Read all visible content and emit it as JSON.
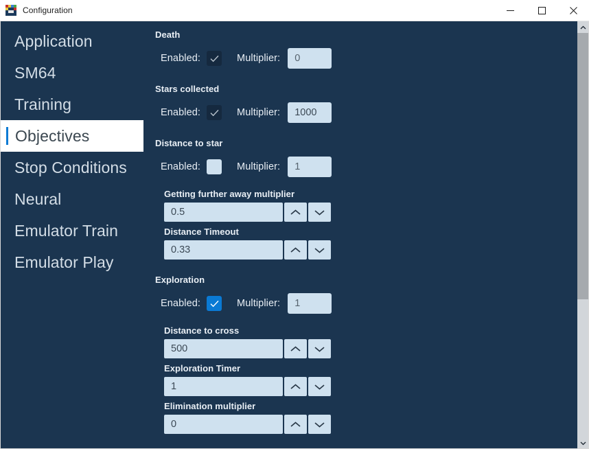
{
  "window": {
    "title": "Configuration",
    "icon": "app-icon",
    "controls": {
      "minimize": "minimize-icon",
      "maximize": "maximize-icon",
      "close": "close-icon"
    }
  },
  "sidebar": {
    "items": [
      {
        "label": "Application",
        "selected": false
      },
      {
        "label": "SM64",
        "selected": false
      },
      {
        "label": "Training",
        "selected": false
      },
      {
        "label": "Objectives",
        "selected": true
      },
      {
        "label": "Stop Conditions",
        "selected": false
      },
      {
        "label": "Neural",
        "selected": false
      },
      {
        "label": "Emulator Train",
        "selected": false
      },
      {
        "label": "Emulator Play",
        "selected": false
      }
    ],
    "accent_color": "#0a7ad4"
  },
  "content": {
    "enabled_label": "Enabled:",
    "multiplier_label": "Multiplier:",
    "sections": [
      {
        "title": "Death",
        "checkbox_state": "checked-dark",
        "multiplier": "0",
        "spinners": []
      },
      {
        "title": "Stars collected",
        "checkbox_state": "checked-dark",
        "multiplier": "1000",
        "spinners": []
      },
      {
        "title": "Distance to star",
        "checkbox_state": "unchecked",
        "multiplier": "1",
        "spinners": [
          {
            "label": "Getting further away multiplier",
            "value": "0.5"
          },
          {
            "label": "Distance Timeout",
            "value": "0.33"
          }
        ]
      },
      {
        "title": "Exploration",
        "checkbox_state": "checked-blue",
        "multiplier": "1",
        "spinners": [
          {
            "label": "Distance to cross",
            "value": "500"
          },
          {
            "label": "Exploration Timer",
            "value": "1"
          },
          {
            "label": "Elimination multiplier",
            "value": "0"
          }
        ]
      }
    ]
  },
  "scrollbar": {
    "up_icon": "chevron-up-icon",
    "down_icon": "chevron-down-icon",
    "thumb_name": "scrollbar-thumb"
  },
  "colors": {
    "background": "#1b3550",
    "accent": "#0a7ad4",
    "field": "#cfe1ef",
    "text": "#e9eff5"
  }
}
